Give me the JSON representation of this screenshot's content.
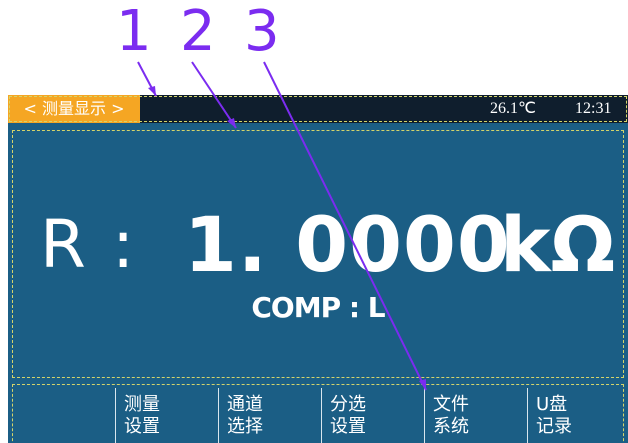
{
  "callouts": [
    "1",
    "2",
    "3"
  ],
  "topbar": {
    "title": "< 测量显示 >",
    "temperature": "26.1℃",
    "time": "12:31"
  },
  "reading": {
    "parameter": "R",
    "colon": ":",
    "value": "1. 0000",
    "unit": "kΩ"
  },
  "comp": "COMP : L",
  "softkeys": [
    {
      "line1": "",
      "line2": ""
    },
    {
      "line1": "测量",
      "line2": "设置"
    },
    {
      "line1": "通道",
      "line2": "选择"
    },
    {
      "line1": "分选",
      "line2": "设置"
    },
    {
      "line1": "文件",
      "line2": "系统"
    },
    {
      "line1": "U盘",
      "line2": "记录"
    }
  ],
  "colors": {
    "screen": "#1b5e85",
    "topbar": "#0f1e2d",
    "tab": "#f5a623",
    "callout": "#7b2cf0",
    "frame": "#d4d46a"
  }
}
